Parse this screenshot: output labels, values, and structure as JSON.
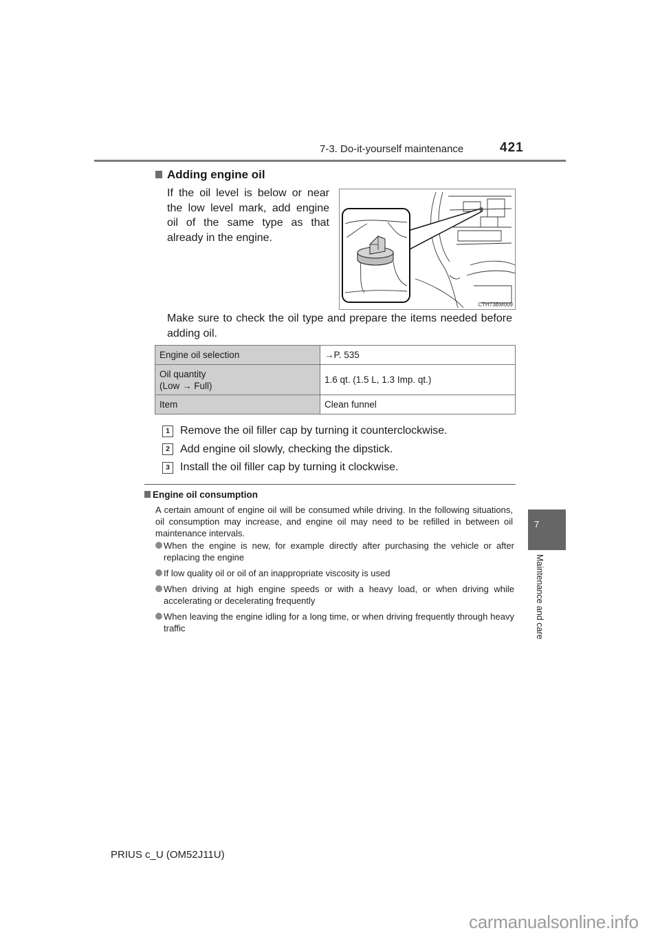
{
  "header": {
    "section": "7-3. Do-it-yourself maintenance",
    "page_number": "421"
  },
  "main": {
    "heading": "Adding engine oil",
    "intro": "If the oil level is below or near the low level mark, add engine oil of the same type as that already in the engine.",
    "illustration": {
      "code": "CTH73BM009",
      "subject": "oil filler cap location in engine compartment"
    },
    "note": "Make sure to check the oil type and prepare the items needed before adding oil.",
    "table": {
      "rows": [
        {
          "key": "Engine oil selection",
          "key_line2": "",
          "value": "→P. 535"
        },
        {
          "key": "Oil quantity",
          "key_line2": "(Low → Full)",
          "value": "1.6 qt. (1.5 L, 1.3 Imp. qt.)"
        },
        {
          "key": "Item",
          "key_line2": "",
          "value": "Clean funnel"
        }
      ]
    },
    "steps": [
      {
        "num": "1",
        "text": "Remove the oil filler cap by turning it counterclockwise."
      },
      {
        "num": "2",
        "text": "Add engine oil slowly, checking the dipstick."
      },
      {
        "num": "3",
        "text": "Install the oil filler cap by turning it clockwise."
      }
    ]
  },
  "consumption": {
    "heading": "Engine oil consumption",
    "paragraph": "A certain amount of engine oil will be consumed while driving. In the following situations, oil consumption may increase, and engine oil may need to be refilled in between oil maintenance intervals.",
    "bullets": [
      "When the engine is new, for example directly after purchasing the vehicle or after replacing the engine",
      "If low quality oil or oil of an inappropriate viscosity is used",
      "When driving at high engine speeds or with a heavy load, or when driving while accelerating or decelerating frequently",
      "When leaving the engine idling for a long time, or when driving frequently through heavy traffic"
    ]
  },
  "side_tab": {
    "number": "7",
    "label": "Maintenance and care"
  },
  "footer": {
    "model": "PRIUS c_U (OM52J11U)"
  },
  "watermark": "carmanualsonline.info",
  "colors": {
    "tab": "#666666",
    "table_key_bg": "#cfcfcf",
    "heading_marker": "#6e6e6e",
    "bullet": "#8a8a8a"
  }
}
